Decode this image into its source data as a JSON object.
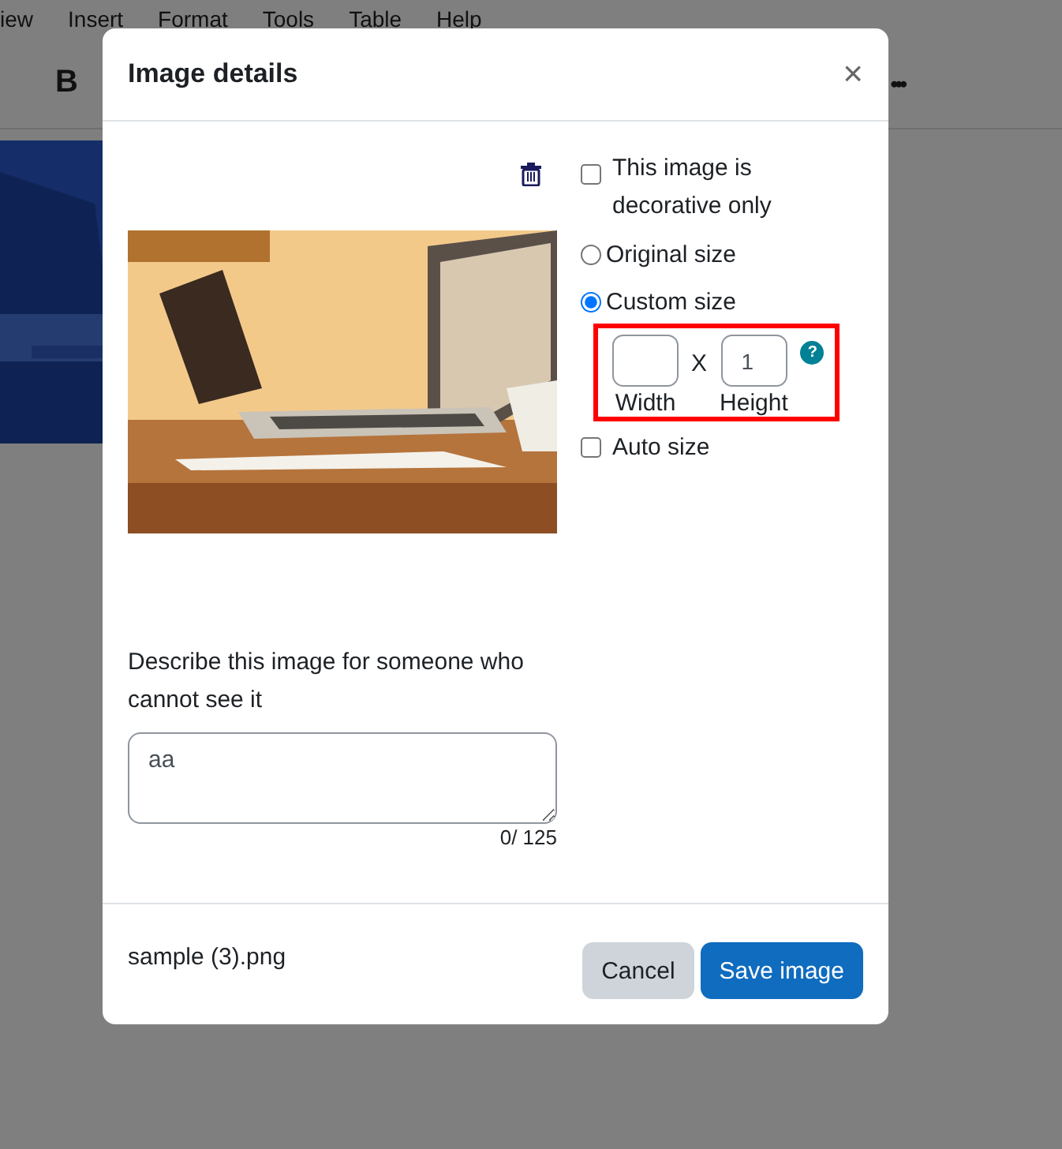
{
  "editor": {
    "menu": [
      "iew",
      "Insert",
      "Format",
      "Tools",
      "Table",
      "Help"
    ],
    "toolbar": {
      "bold": "B",
      "more": "•••"
    }
  },
  "dialog": {
    "title": "Image details",
    "close": "×",
    "decorative": {
      "label": "This image is decorative only",
      "checked": false
    },
    "size_options": [
      {
        "label": "Original size",
        "selected": false
      },
      {
        "label": "Custom size",
        "selected": true
      }
    ],
    "custom_size": {
      "highlighted": true,
      "separator": "X",
      "height_value": "1",
      "width_label": "Width",
      "height_label": "Height",
      "help": "?"
    },
    "auto_size": {
      "label": "Auto size",
      "checked": false
    },
    "description": {
      "label": "Describe this image for someone who cannot see it",
      "value": "aa",
      "counter": "0/ 125"
    },
    "filename": "sample (3).png",
    "buttons": [
      {
        "label": "Cancel",
        "kind": "secondary"
      },
      {
        "label": "Save image",
        "kind": "primary"
      }
    ]
  }
}
